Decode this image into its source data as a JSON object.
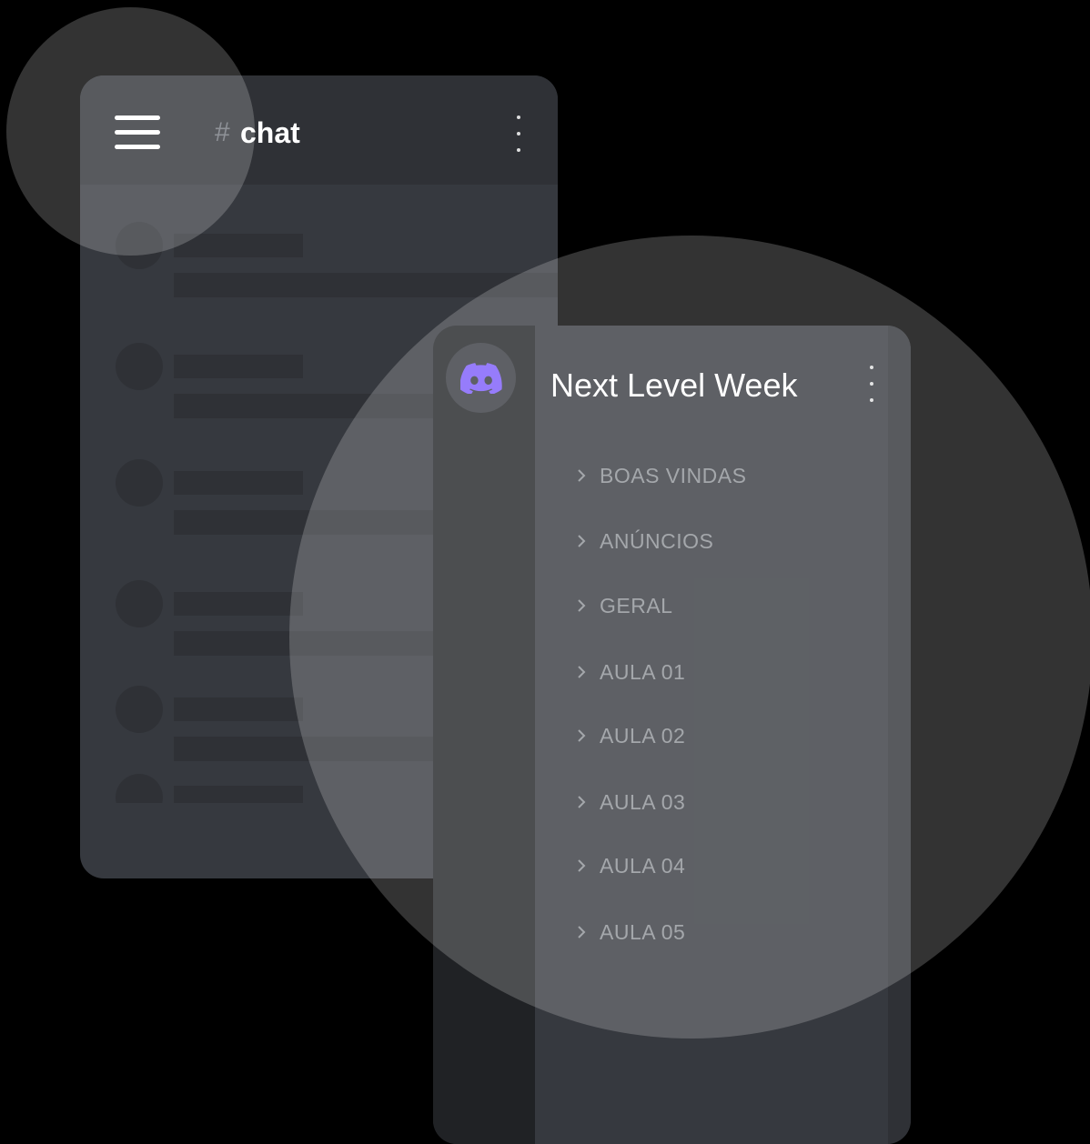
{
  "chat_header": {
    "hash_symbol": "#",
    "channel_name": "chat"
  },
  "server_panel": {
    "server_name": "Next Level Week",
    "categories": [
      {
        "label": "BOAS VINDAS"
      },
      {
        "label": "ANÚNCIOS"
      },
      {
        "label": "GERAL"
      },
      {
        "label": "AULA 01"
      },
      {
        "label": "AULA 02"
      },
      {
        "label": "AULA 03"
      },
      {
        "label": "AULA 04"
      },
      {
        "label": "AULA 05"
      }
    ]
  },
  "icons": {
    "menu": "hamburger-menu-icon",
    "more": "vertical-dots-icon",
    "server": "discord-logo-icon",
    "category": "chevron-right-icon"
  },
  "colors": {
    "background": "#000000",
    "card": "#36393f",
    "header": "#2f3136",
    "rail": "#202225",
    "brand": "#7c5cfa",
    "muted_text": "#8e9297"
  }
}
